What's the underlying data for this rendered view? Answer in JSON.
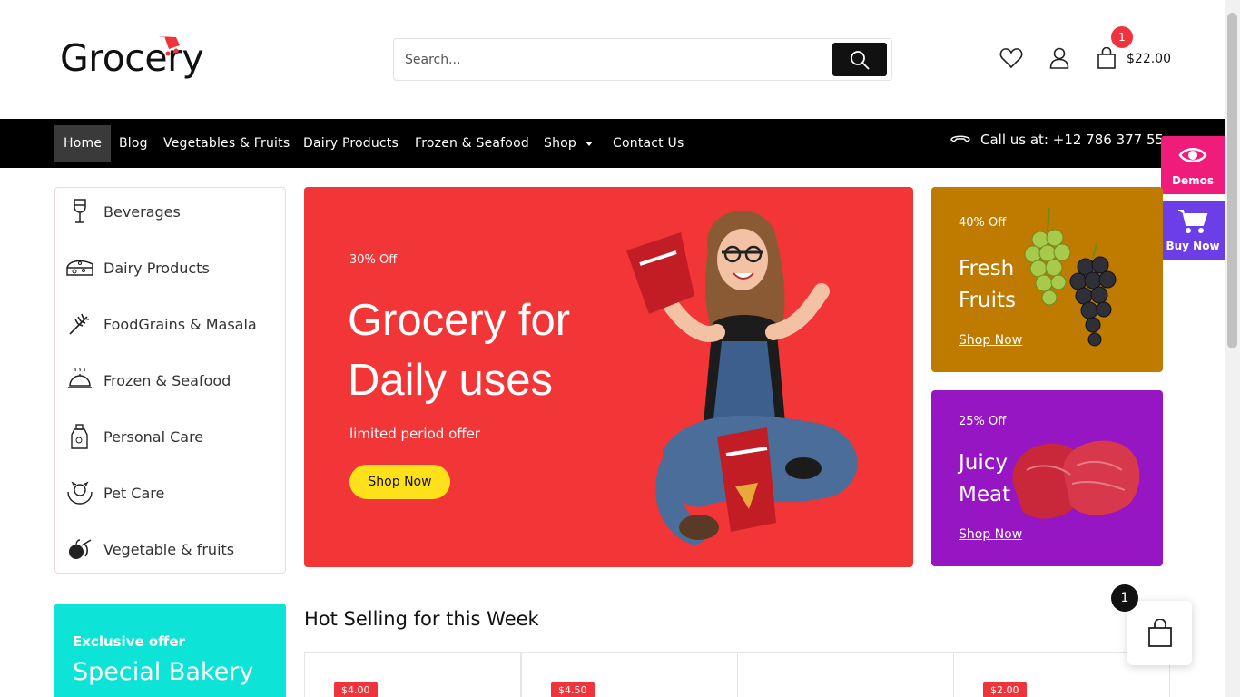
{
  "header": {
    "logo_text": "Grocery",
    "search_placeholder": "Search...",
    "cart_count": "1",
    "cart_total": "$22.00",
    "icons": [
      "heart-icon",
      "user-icon",
      "shopping-bag-icon",
      "search-icon"
    ]
  },
  "nav": {
    "items": [
      {
        "label": "Home",
        "active": true
      },
      {
        "label": "Blog"
      },
      {
        "label": "Vegetables & Fruits"
      },
      {
        "label": "Dairy Products"
      },
      {
        "label": "Frozen & Seafood"
      },
      {
        "label": "Shop",
        "has_dropdown": true
      },
      {
        "label": "Contact Us"
      }
    ],
    "call_text": "Call us at: +12 786 377 55"
  },
  "side_buttons": {
    "demos": "Demos",
    "buy_now": "Buy Now",
    "demos_color": "#f01c7b",
    "buy_color": "#6b3ee8"
  },
  "categories": [
    {
      "label": "Beverages",
      "icon": "wine-glass-icon"
    },
    {
      "label": "Dairy Products",
      "icon": "cheese-icon"
    },
    {
      "label": "FoodGrains & Masala",
      "icon": "wheat-icon"
    },
    {
      "label": "Frozen & Seafood",
      "icon": "cloche-icon"
    },
    {
      "label": "Personal Care",
      "icon": "bottles-icon"
    },
    {
      "label": "Pet Care",
      "icon": "pet-hands-icon"
    },
    {
      "label": "Vegetable & fruits",
      "icon": "fruits-icon"
    }
  ],
  "hero": {
    "discount": "30% Off",
    "title": "Grocery for Daily uses",
    "subtitle": "limited period offer",
    "button": "Shop Now",
    "bg_color": "#f23536"
  },
  "promos": [
    {
      "discount": "40% Off",
      "title": "Fresh Fruits",
      "link": "Shop Now",
      "bg_color": "#bf7a00"
    },
    {
      "discount": "25% Off",
      "title": "Juicy Meat",
      "link": "Shop Now",
      "bg_color": "#9516c2"
    }
  ],
  "bakery": {
    "kicker": "Exclusive offer",
    "title": "Special Bakery",
    "bg_color": "#0ee3d8"
  },
  "hot_selling": {
    "title": "Hot Selling for this Week",
    "prices": [
      "$4.00",
      "$4.50",
      "",
      "$2.00"
    ]
  },
  "floating_cart": {
    "count": "1"
  }
}
